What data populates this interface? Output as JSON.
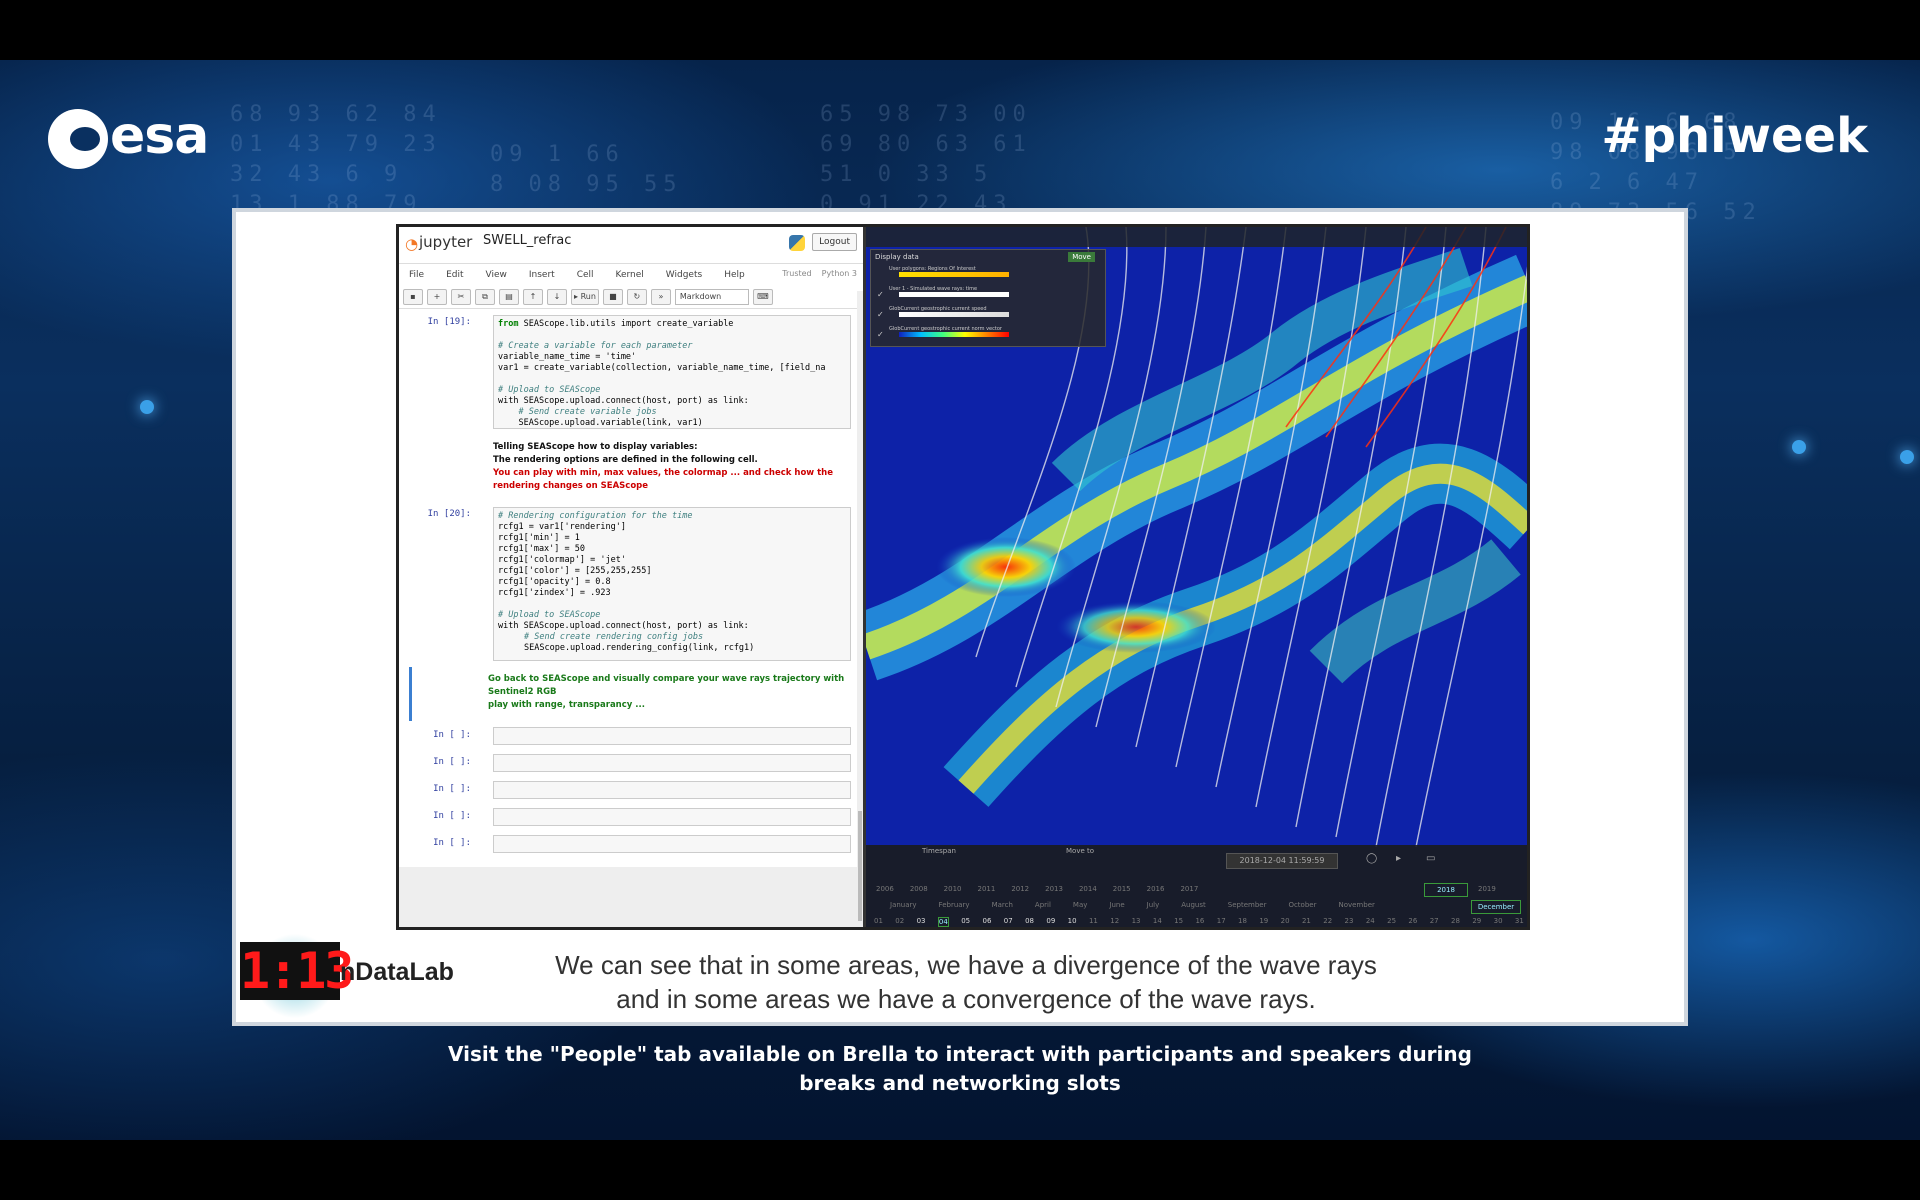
{
  "brand": {
    "esa_text": "esa",
    "hashtag": "#phiweek"
  },
  "notebook": {
    "app_name": "jupyter",
    "notebook_title": "SWELL_refrac",
    "logout_label": "Logout",
    "menu": [
      "File",
      "Edit",
      "View",
      "Insert",
      "Cell",
      "Kernel",
      "Widgets",
      "Help"
    ],
    "trusted_label": "Trusted",
    "kernel_label": "Python 3",
    "toolbar": {
      "run_label": "Run",
      "cell_type": "Markdown"
    },
    "cell19": {
      "prompt": "In [19]:",
      "lines": [
        "from SEAScope.lib.utils import create_variable",
        "",
        "# Create a variable for each parameter",
        "variable_name_time = 'time'",
        "var1 = create_variable(collection, variable_name_time, [field_na",
        "",
        "# Upload to SEAScope",
        "with SEAScope.upload.connect(host, port) as link:",
        "    # Send create variable jobs",
        "    SEAScope.upload.variable(link, var1)"
      ]
    },
    "markdown1": {
      "line1": "Telling SEAScope how to display variables:",
      "line2": "The rendering options are defined in the following cell.",
      "line3": "You can play with min, max values, the colormap ... and check how the",
      "line4": "rendering changes on SEAScope"
    },
    "cell20": {
      "prompt": "In [20]:",
      "lines": [
        "# Rendering configuration for the time",
        "rcfg1 = var1['rendering']",
        "rcfg1['min'] = 1",
        "rcfg1['max'] = 50",
        "rcfg1['colormap'] = 'jet'",
        "rcfg1['color'] = [255,255,255]",
        "rcfg1['opacity'] = 0.8",
        "rcfg1['zindex'] = .923",
        "",
        "# Upload to SEAScope",
        "with SEAScope.upload.connect(host, port) as link:",
        "    # Send create rendering config jobs",
        "    SEAScope.upload.rendering_config(link, rcfg1)"
      ]
    },
    "markdown2": {
      "line1": "Go back to SEAScope and visually compare your wave rays trajectory with",
      "line2": "Sentinel2 RGB",
      "line3": "play with range, transparancy ..."
    },
    "empty_prompt": "In [ ]:"
  },
  "viewer": {
    "panel_title": "Display data",
    "panel_move": "Move",
    "layers": [
      "User polygons: Regions Of Interest",
      "User 1 - Simulated wave rays: time",
      "GlobCurrent geostrophic current speed",
      "GlobCurrent geostrophic current norm vector"
    ],
    "timebar": {
      "timespan_label": "Timespan",
      "move_to_label": "Move to",
      "datetime": "2018-12-04 11:59:59",
      "years": [
        "2006",
        "2008",
        "2010",
        "2011",
        "2012",
        "2013",
        "2014",
        "2015",
        "2016",
        "2017",
        "2018",
        "2019"
      ],
      "selected_year": "2018",
      "months": [
        "January",
        "February",
        "March",
        "April",
        "May",
        "June",
        "July",
        "August",
        "September",
        "October",
        "November"
      ],
      "selected_month": "December",
      "days": [
        "01",
        "02",
        "03",
        "04",
        "05",
        "06",
        "07",
        "08",
        "09",
        "10",
        "11",
        "12",
        "13",
        "14",
        "15",
        "16",
        "17",
        "18",
        "19",
        "20",
        "21",
        "22",
        "23",
        "24",
        "25",
        "26",
        "27",
        "28",
        "29",
        "30",
        "31"
      ]
    }
  },
  "slide": {
    "counter": "1:13",
    "lab_name": "nDataLab",
    "subtitle_line1": "We can see that in some areas, we have a divergence of the wave rays",
    "subtitle_line2": "and in some areas we have a convergence of the wave rays."
  },
  "banner": {
    "text": "Visit the \"People\" tab available on Brella to interact with participants and speakers during breaks and networking slots"
  },
  "colors": {
    "accent": "#0b1c8a",
    "counter_red": "#ff1a1a",
    "md_red": "#cc0000",
    "md_green": "#1a7a1a"
  }
}
